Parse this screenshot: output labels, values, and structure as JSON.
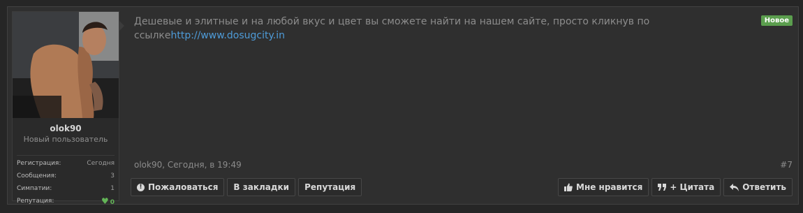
{
  "post": {
    "message_text": "Дешевые и элитные и на любой вкус и цвет вы сможете найти на нашем сайте, просто кликнув по ссылке",
    "message_link": "http://www.dosugcity.in",
    "badge": "Новое",
    "meta": "olok90, Сегодня, в 19:49",
    "number": "#7"
  },
  "user": {
    "name": "olok90",
    "title": "Новый пользователь",
    "stats": [
      {
        "label": "Регистрация:",
        "value": "Сегодня"
      },
      {
        "label": "Сообщения:",
        "value": "3"
      },
      {
        "label": "Симпатии:",
        "value": "1"
      },
      {
        "label": "Репутация:",
        "value": "0"
      }
    ]
  },
  "actions": {
    "report": "Пожаловаться",
    "bookmark": "В закладки",
    "reputation": "Репутация",
    "like": "Мне нравится",
    "quote": "+ Цитата",
    "reply": "Ответить"
  },
  "icons": {
    "report": "exclamation-circle-icon",
    "like": "thumbs-up-icon",
    "quote": "quote-icon",
    "reply": "reply-arrow-icon",
    "reputation": "heart-icon"
  },
  "colors": {
    "background": "#262626",
    "panel": "#2f2f2f",
    "link": "#4e9bd8",
    "badge": "#5b9e4e",
    "heart": "#63b557"
  }
}
